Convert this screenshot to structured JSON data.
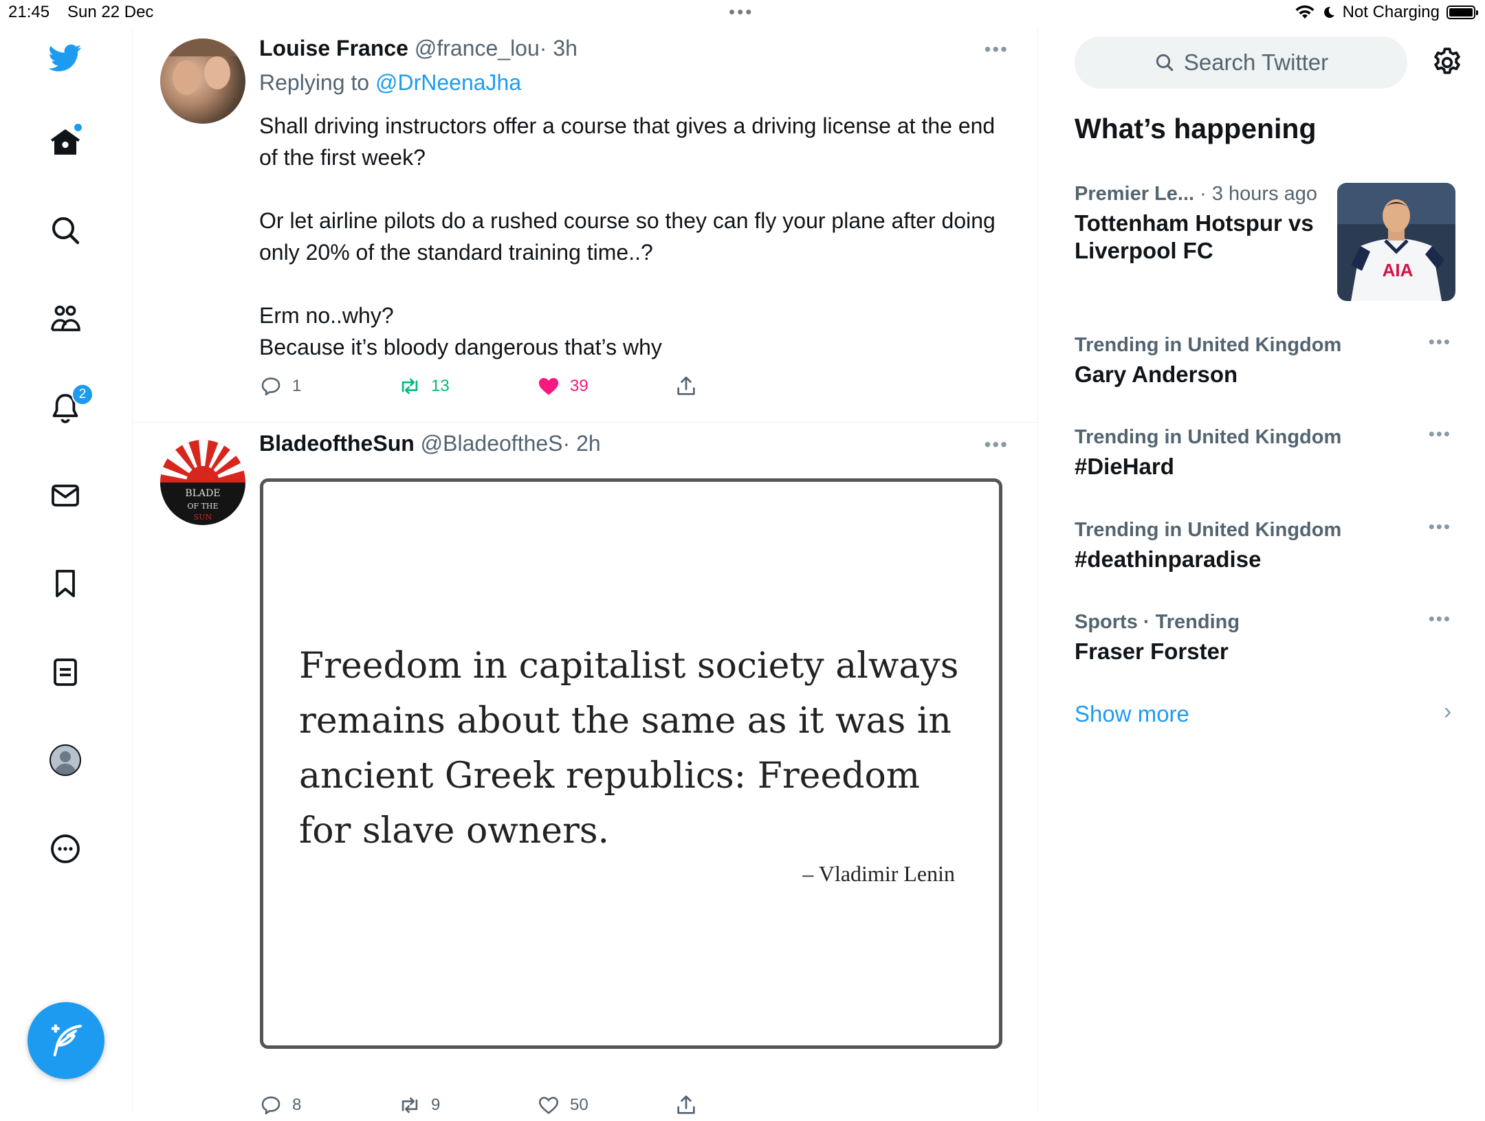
{
  "status_bar": {
    "time": "21:45",
    "date": "Sun 22 Dec",
    "dots": "•••",
    "charging": "Not Charging"
  },
  "nav": {
    "items": [
      "twitter-logo",
      "home",
      "explore",
      "communities",
      "notifications",
      "messages",
      "bookmarks",
      "lists",
      "profile",
      "more"
    ],
    "notifications_badge": "2"
  },
  "tweets": [
    {
      "name": "Louise France",
      "handle": "@france_lou",
      "time": "· 3h",
      "replying_label": "Replying to",
      "replying_to": "@DrNeenaJha",
      "paragraphs": [
        "Shall driving instructors offer a course that gives a driving license at the end of the first week?",
        "Or let airline pilots do a rushed course so they can fly your plane after doing only 20% of the standard training time..?",
        "Erm no..why?\nBecause it’s bloody dangerous that’s why"
      ],
      "replies": "1",
      "retweets": "13",
      "likes": "39",
      "liked": true
    },
    {
      "name": "BladeoftheSun",
      "handle": "@BladeoftheS",
      "time": "· 2h",
      "avatar_text": "BLADE OF THE SUN",
      "image_quote": "Freedom in capitalist society always remains about the same as it was in ancient Greek republics: Freedom for slave owners.",
      "image_author": "– Vladimir Lenin",
      "replies": "8",
      "retweets": "9",
      "likes": "50",
      "liked": false
    }
  ],
  "sidebar": {
    "search_placeholder": "Search Twitter",
    "heading": "What’s happening",
    "trends": [
      {
        "category": "Premier Le...",
        "time": " · 3 hours ago",
        "title": "Tottenham Hotspur vs Liverpool FC",
        "has_image": true,
        "image_sponsor": "AIA"
      },
      {
        "category": "Trending in United Kingdom",
        "title": "Gary Anderson"
      },
      {
        "category": "Trending in United Kingdom",
        "title": "#DieHard"
      },
      {
        "category": "Trending in United Kingdom",
        "title": "#deathinparadise"
      },
      {
        "category": "Sports · Trending",
        "title": "Fraser Forster"
      }
    ],
    "show_more": "Show more"
  },
  "colors": {
    "brand_blue": "#1d9bf0",
    "like_pink": "#f91880",
    "retweet_green": "#00ba7c",
    "secondary_text": "#536471"
  }
}
